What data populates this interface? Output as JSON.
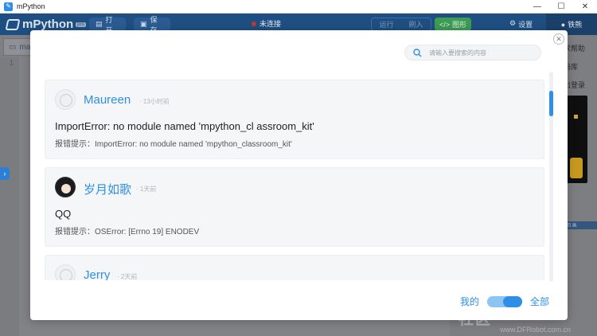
{
  "window": {
    "title": "mPython",
    "controls": [
      "—",
      "☐",
      "✕"
    ]
  },
  "appbar": {
    "logo": "mPython",
    "logo_badge": "pro",
    "open_label": "打开",
    "save_label": "保存",
    "connection": "未连接",
    "run_label": "运行",
    "flash_label": "刷入",
    "graph_label": "图形",
    "settings_label": "设置",
    "user_label": "铁熊"
  },
  "workspace": {
    "file_tab": "ma",
    "line_number": "1",
    "right_menu": [
      "求帮助",
      "码库",
      "出登录"
    ],
    "mini_bar": "回 画"
  },
  "watermark": {
    "brand": "社区",
    "url": "www.DFRobot.com.cn"
  },
  "modal": {
    "search_placeholder": "请输入要搜索的内容",
    "posts": [
      {
        "name": "Maureen",
        "time": "· 13小时前",
        "message": "ImportError: no module named 'mpython_cl assroom_kit'",
        "detail": "报错提示：ImportError: no module named 'mpython_classroom_kit'"
      },
      {
        "name": "岁月如歌",
        "time": "· 1天前",
        "message": "QQ",
        "detail": "报错提示：OSError: [Errno 19] ENODEV"
      },
      {
        "name": "Jerry",
        "time": "· 2天前",
        "message": "",
        "detail": ""
      }
    ],
    "footer": {
      "mine_label": "我的",
      "all_label": "全部",
      "toggle_on": true
    }
  },
  "colors": {
    "accent": "#2f8fe6",
    "title_bar": "#1f4f82",
    "overlay": "#7f8186"
  }
}
